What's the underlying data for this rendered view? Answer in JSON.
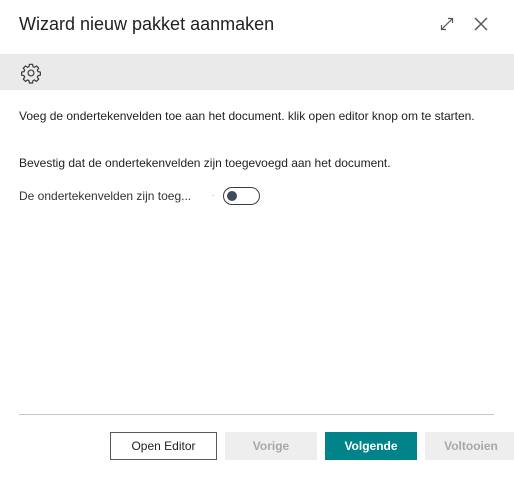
{
  "dialog": {
    "title": "Wizard nieuw pakket aanmaken",
    "expand_icon": "expand-icon",
    "close_icon": "close-icon"
  },
  "actionbar": {
    "settings_icon": "gear-icon"
  },
  "content": {
    "instructions": "Voeg de ondertekenvelden toe aan het document. klik open editor knop om te starten.",
    "confirm_text": "Bevestig dat de ondertekenvelden zijn toegevoegd aan het document.",
    "field_label": "De ondertekenvelden zijn toeg...",
    "field_value": false
  },
  "footer": {
    "open_editor": "Open Editor",
    "previous": "Vorige",
    "next": "Volgende",
    "finish": "Voltooien"
  },
  "colors": {
    "primary": "#008489",
    "actionbar_bg": "#eaeaea",
    "disabled_bg": "#eeeeee"
  }
}
